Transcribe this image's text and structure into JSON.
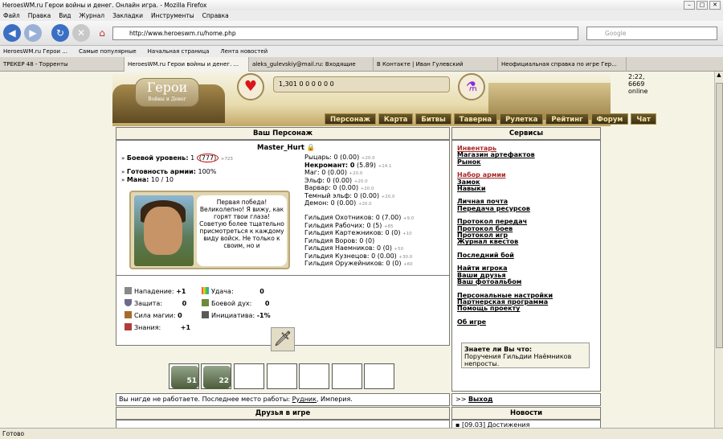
{
  "browser": {
    "title": "HeroesWM.ru Герои войны и денег. Онлайн игра. - Mozilla Firefox",
    "menu": [
      "Файл",
      "Правка",
      "Вид",
      "Журнал",
      "Закладки",
      "Инструменты",
      "Справка"
    ],
    "url": "http://www.heroeswm.ru/home.php",
    "search_placeholder": "Google",
    "bookmarks": [
      "HeroesWM.ru Герои ...",
      "Самые популярные",
      "Начальная страница",
      "Лента новостей"
    ],
    "tabs": [
      "ТРЕКЕР 48 - Торренты",
      "HeroesWM.ru Герои войны и денег. ...",
      "aleks_gulevskiy@mail.ru: Входящие",
      "В Контакте | Иван Гулевский",
      "Неофициальная справка по игре Гер..."
    ],
    "status": "Готово"
  },
  "header": {
    "logo": "Герои",
    "logo_sub": "Войны и Денег",
    "resources": "1,301   0   0   0   0   0   0",
    "online": "2:22, 6669 online",
    "nav": [
      "Персонаж",
      "Карта",
      "Битвы",
      "Таверна",
      "Рулетка",
      "Рейтинг",
      "Форум",
      "Чат"
    ]
  },
  "character": {
    "panel_title": "Ваш Персонаж",
    "name": "Master_Hurt",
    "level_label": "Боевой уровень:",
    "level": "1",
    "level_exp": "(777)",
    "level_exp_note": "+723",
    "army_label": "Готовность армии:",
    "army": "100%",
    "mana_label": "Мана:",
    "mana": "10 / 10",
    "speech": "Первая победа! Великолепно! Я вижу, как горят твои глаза! Советую более тщательно присмотреться к каждому виду войск. Не только к своим, но и",
    "factions": [
      {
        "name": "Рыцарь: 0 (0.00)",
        "note": "+20.0",
        "bold": false
      },
      {
        "name": "Некромант: 0",
        "extra": "(5.89)",
        "note": "+14.1",
        "bold": true
      },
      {
        "name": "Маг: 0 (0.00)",
        "note": "+20.0",
        "bold": false
      },
      {
        "name": "Эльф: 0 (0.00)",
        "note": "+20.0",
        "bold": false
      },
      {
        "name": "Варвар: 0 (0.00)",
        "note": "+20.0",
        "bold": false
      },
      {
        "name": "Темный эльф: 0 (0.00)",
        "note": "+20.0",
        "bold": false
      },
      {
        "name": "Демон: 0 (0.00)",
        "note": "+20.0",
        "bold": false
      }
    ],
    "guilds": [
      {
        "name": "Гильдия Охотников: 0 (7.00)",
        "note": "+9.0"
      },
      {
        "name": "Гильдия Рабочих: 0 (5)",
        "note": "+85"
      },
      {
        "name": "Гильдия Картежников: 0 (0)",
        "note": "+10"
      },
      {
        "name": "Гильдия Воров: 0 (0)",
        "note": ""
      },
      {
        "name": "Гильдия Наемников: 0 (0)",
        "note": "+50"
      },
      {
        "name": "Гильдия Кузнецов: 0 (0.00)",
        "note": "+30.0"
      },
      {
        "name": "Гильдия Оружейников: 0 (0)",
        "note": "+60"
      }
    ],
    "stats": {
      "attack_label": "Нападение:",
      "attack": "+1",
      "defense_label": "Защита:",
      "defense": "0",
      "magic_label": "Сила магии:",
      "magic": "0",
      "knowledge_label": "Знания:",
      "knowledge": "+1",
      "luck_label": "Удача:",
      "luck": "0",
      "morale_label": "Боевой дух:",
      "morale": "0",
      "initiative_label": "Инициатива:",
      "initiative": "-1%"
    },
    "army_counts": [
      "51",
      "22"
    ],
    "work_text": "Вы нигде не работаете. Последнее место работы:",
    "work_place": "Рудник",
    "work_region": ", Империя.",
    "friends_title": "Друзья в игре"
  },
  "services": {
    "title": "Сервисы",
    "groups": [
      [
        "Инвентарь",
        "Магазин артефактов",
        "Рынок"
      ],
      [
        "Набор армии",
        "Замок",
        "Навыки"
      ],
      [
        "Личная почта",
        "Передача ресурсов"
      ],
      [
        "Протокол передач",
        "Протокол боев",
        "Протокол игр",
        "Журнал квестов"
      ],
      [
        "Последний бой"
      ],
      [
        "Найти игрока",
        "Ваши друзья",
        "Ваш фотоальбом"
      ],
      [
        "Персональные настройки",
        "Партнерская программа",
        "Помощь проекту"
      ],
      [
        "Об игре"
      ]
    ],
    "tip_title": "Знаете ли Вы что:",
    "tip": "Поручения Гильдии Наёмников непросты.",
    "exit_prefix": ">>",
    "exit": "Выход",
    "news_title": "Новости",
    "news_item": "[09.03] Достижения"
  }
}
